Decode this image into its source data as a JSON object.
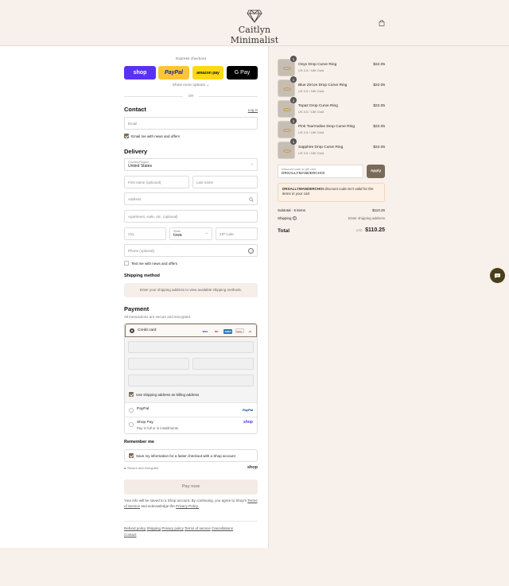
{
  "header": {
    "brand": "Caitlyn Minimalist"
  },
  "express": {
    "label": "Express checkout",
    "shop_label": "shop",
    "paypal_label": "PayPal",
    "amazon_label": "amazon pay",
    "gpay_label": "G Pay",
    "more_label": "Show more options",
    "or_label": "OR"
  },
  "contact": {
    "title": "Contact",
    "login_label": "Log in",
    "email_placeholder": "Email",
    "news_label": "Email me with news and offers"
  },
  "delivery": {
    "title": "Delivery",
    "country_label": "Country/Region",
    "country_value": "United States",
    "first_name": "First name (optional)",
    "last_name": "Last name",
    "address": "Address",
    "apartment": "Apartment, suite, etc. (optional)",
    "city": "City",
    "state_label": "State",
    "state_value": "Iowa",
    "zip": "ZIP code",
    "phone": "Phone (optional)",
    "text_label": "Text me with news and offers"
  },
  "shipping": {
    "title": "Shipping method",
    "note": "Enter your shipping address to view available shipping methods."
  },
  "payment": {
    "title": "Payment",
    "subtitle": "All transactions are secure and encrypted.",
    "credit_card_label": "Credit card",
    "card_logos": [
      "VISA",
      "MC",
      "AMEX",
      "DISC",
      "+6"
    ],
    "billing_label": "Use shipping address as billing address",
    "paypal_label": "PayPal",
    "paypal_logo": "PayPal",
    "shoppay_label": "Shop Pay",
    "shoppay_sub": "Pay in full or in installments",
    "shoppay_logo": "shop"
  },
  "remember": {
    "title": "Remember me",
    "save_label": "Save my information for a faster checkout with a Shop account",
    "secure_label": "Secure and encrypted",
    "shop_logo": "shop"
  },
  "pay_button": "Pay now",
  "legal": {
    "text1": "Your info will be saved to a Shop account. By continuing, you agree to Shop's",
    "tos": "Terms of Service",
    "text2": "and acknowledge the",
    "privacy": "Privacy Policy."
  },
  "footer_links": [
    "Refund policy",
    "Shipping",
    "Privacy policy",
    "Terms of service",
    "Cancellations",
    "Contact"
  ],
  "cart": {
    "items": [
      {
        "name": "Onyx Drop Curve Ring",
        "variant": "US 3.5 / 18K Gold",
        "price": "$22.05",
        "qty": "1"
      },
      {
        "name": "Blue Zircon Drop Curve Ring",
        "variant": "US 3.5 / 18K Gold",
        "price": "$22.05",
        "qty": "1"
      },
      {
        "name": "Topaz Drop Curve Ring",
        "variant": "US 3.5 / 18K Gold",
        "price": "$22.05",
        "qty": "1"
      },
      {
        "name": "Pink Tourmaline Drop Curve Ring",
        "variant": "US 3.5 / 18K Gold",
        "price": "$22.05",
        "qty": "1"
      },
      {
        "name": "Sapphire Drop Curve Ring",
        "variant": "US 3.5 / 18K Gold",
        "price": "$22.05",
        "qty": "1"
      }
    ],
    "discount_label": "Discount code or gift card",
    "discount_value": "DRSALLYMANDERCHOI",
    "apply_label": "Apply",
    "error_code": "DRSALLYMANDERCHOI",
    "error_text": "discount code isn't valid for the items in your cart",
    "subtotal_label": "Subtotal · 5 items",
    "subtotal_value": "$110.25",
    "shipping_label": "Shipping",
    "shipping_value": "Enter shipping address",
    "total_label": "Total",
    "currency": "USD",
    "total_value": "$110.25"
  },
  "colors": {
    "accent": "#7a6a5a",
    "shop": "#5a31f4",
    "paypal": "#ffc439",
    "bg": "#f8f0ea"
  }
}
